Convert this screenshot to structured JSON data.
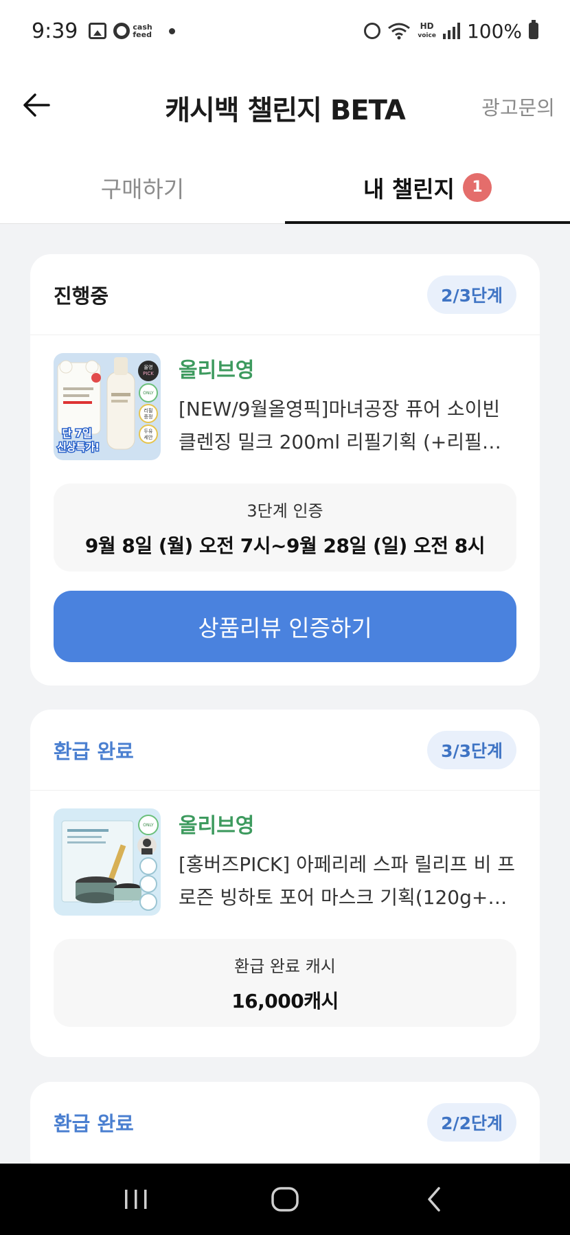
{
  "status_bar": {
    "time": "9:39",
    "cashfeed_text_1": "cash",
    "cashfeed_text_2": "feed",
    "hd_text_1": "HD",
    "hd_text_2": "voice",
    "battery": "100%"
  },
  "header": {
    "title": "캐시백 챌린지 BETA",
    "ad_inquiry": "광고문의"
  },
  "tabs": [
    {
      "label": "구매하기"
    },
    {
      "label": "내 챌린지",
      "badge": "1"
    }
  ],
  "cards": [
    {
      "status": "진행중",
      "stage": "2/3단계",
      "store": "올리브영",
      "product_name": "[NEW/9월올영픽]마녀공장 퓨어 소이빈 클렌징 밀크 200ml 리필기획 (+리필…",
      "thumb_pick": "올영 PICK",
      "thumb_only": "ONLY",
      "thumb_refill": "리필 증정",
      "thumb_soy": "두유 세안",
      "thumb_promo": "단 7일 신상특가!",
      "info_label": "3단계 인증",
      "info_value": "9월 8일 (월) 오전 7시~9월 28일 (일) 오전 8시",
      "button_label": "상품리뷰 인증하기"
    },
    {
      "status": "환급 완료",
      "stage": "3/3단계",
      "store": "올리브영",
      "product_name": "[홍버즈PICK] 아페리레 스파 릴리프 비 프로즌 빙하토 포어 마스크 기획(120g+…",
      "thumb_only": "ONLY",
      "info_label": "환급 완료 캐시",
      "info_value": "16,000캐시"
    },
    {
      "status": "환급 완료",
      "stage": "2/2단계"
    }
  ],
  "colors": {
    "accent_blue": "#4a82de",
    "store_green": "#3d9a5e",
    "badge_red": "#e46d6b"
  }
}
